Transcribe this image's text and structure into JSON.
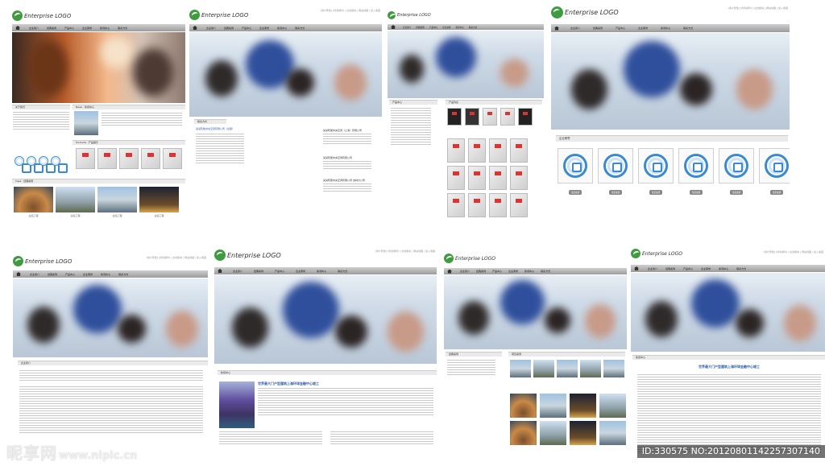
{
  "site": {
    "logo_text": "Enterprise LOGO",
    "top_links": "[用户登陆] [商务邮件] | 在线留言 | 网站地图 | 加入收藏",
    "nav": [
      "企业简介",
      "经典案例",
      "产品中心",
      "企业荣誉",
      "新闻中心",
      "联系方式"
    ]
  },
  "panels": {
    "home": {
      "about_title": "关于我们",
      "news_title": "News · 新闻中心",
      "products_title": "Products · 产品展示",
      "cases_title": "Case · 经典案例",
      "case_captions": [
        "业绩工程",
        "业绩工程",
        "业绩工程",
        "业绩工程"
      ]
    },
    "contact": {
      "section": "联系方式",
      "company_a": "某某晓能中央空调有限公司（总部）",
      "company_b": "某某晓能中央空调（上海）有限公司",
      "company_c": "某某晓能中央空调有限公司",
      "company_d": "某某晓能中央空调有限公司 吉林分公司"
    },
    "products": {
      "section": "产品中心",
      "list": "产品列表"
    },
    "honors": {
      "section": "企业荣誉",
      "cert_labels": [
        "某某资质",
        "某某资质",
        "某某资质",
        "某某资质",
        "某某资质",
        "某某资质"
      ]
    },
    "intro": {
      "section": "企业简介"
    },
    "news": {
      "section": "新闻中心",
      "headline": "世界最大门户型建筑上海环球金融中心竣工"
    },
    "cases": {
      "section_left": "经典案例",
      "section_right": "项目案例"
    },
    "article": {
      "section": "新闻中心",
      "headline": "世界最大门户型建筑上海环球金融中心竣工"
    }
  },
  "watermark": {
    "brand": "昵享网",
    "url": "www.nipic.cn",
    "id_text": "ID:330575 NO:20120801142257307140"
  }
}
